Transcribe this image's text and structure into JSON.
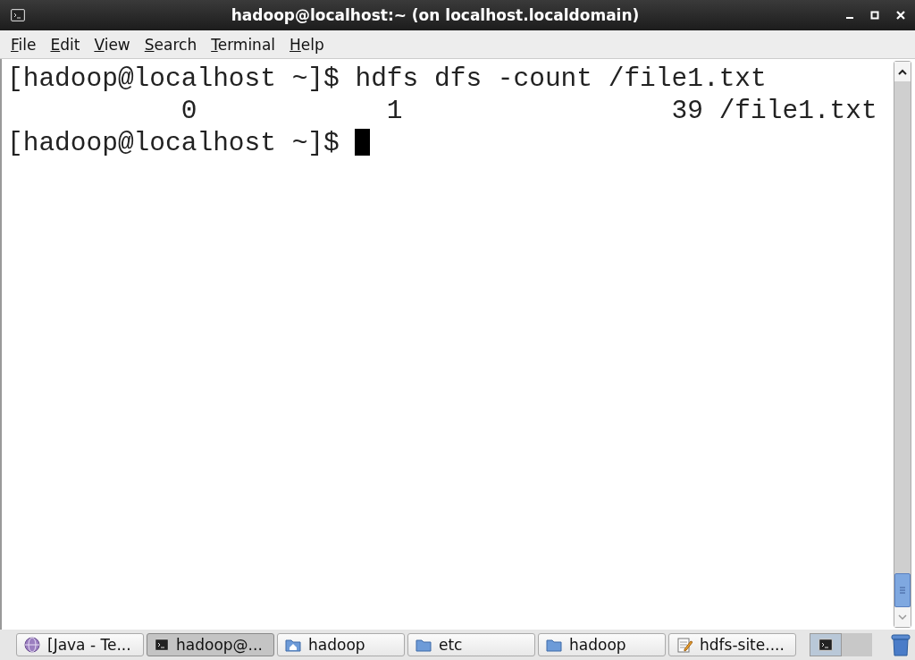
{
  "window": {
    "title": "hadoop@localhost:~ (on localhost.localdomain)"
  },
  "menu": [
    {
      "label": "File"
    },
    {
      "label": "Edit"
    },
    {
      "label": "View"
    },
    {
      "label": "Search"
    },
    {
      "label": "Terminal"
    },
    {
      "label": "Help"
    }
  ],
  "terminal": {
    "lines": [
      {
        "kind": "command",
        "prompt": "[hadoop@localhost ~]$",
        "command": "hdfs dfs -count /file1.txt"
      },
      {
        "kind": "output",
        "text": "           0            1                 39 /file1.txt"
      },
      {
        "kind": "prompt",
        "prompt": "[hadoop@localhost ~]$",
        "cursor": true
      }
    ]
  },
  "taskbar": {
    "items": [
      {
        "kind": "globe",
        "label": "[Java - Te...",
        "selected": false
      },
      {
        "kind": "terminal",
        "label": "hadoop@...",
        "selected": true
      },
      {
        "kind": "home",
        "label": "hadoop",
        "selected": false
      },
      {
        "kind": "folder",
        "label": "etc",
        "selected": false
      },
      {
        "kind": "folder",
        "label": "hadoop",
        "selected": false
      },
      {
        "kind": "editor",
        "label": "hdfs-site....",
        "selected": false
      }
    ]
  }
}
